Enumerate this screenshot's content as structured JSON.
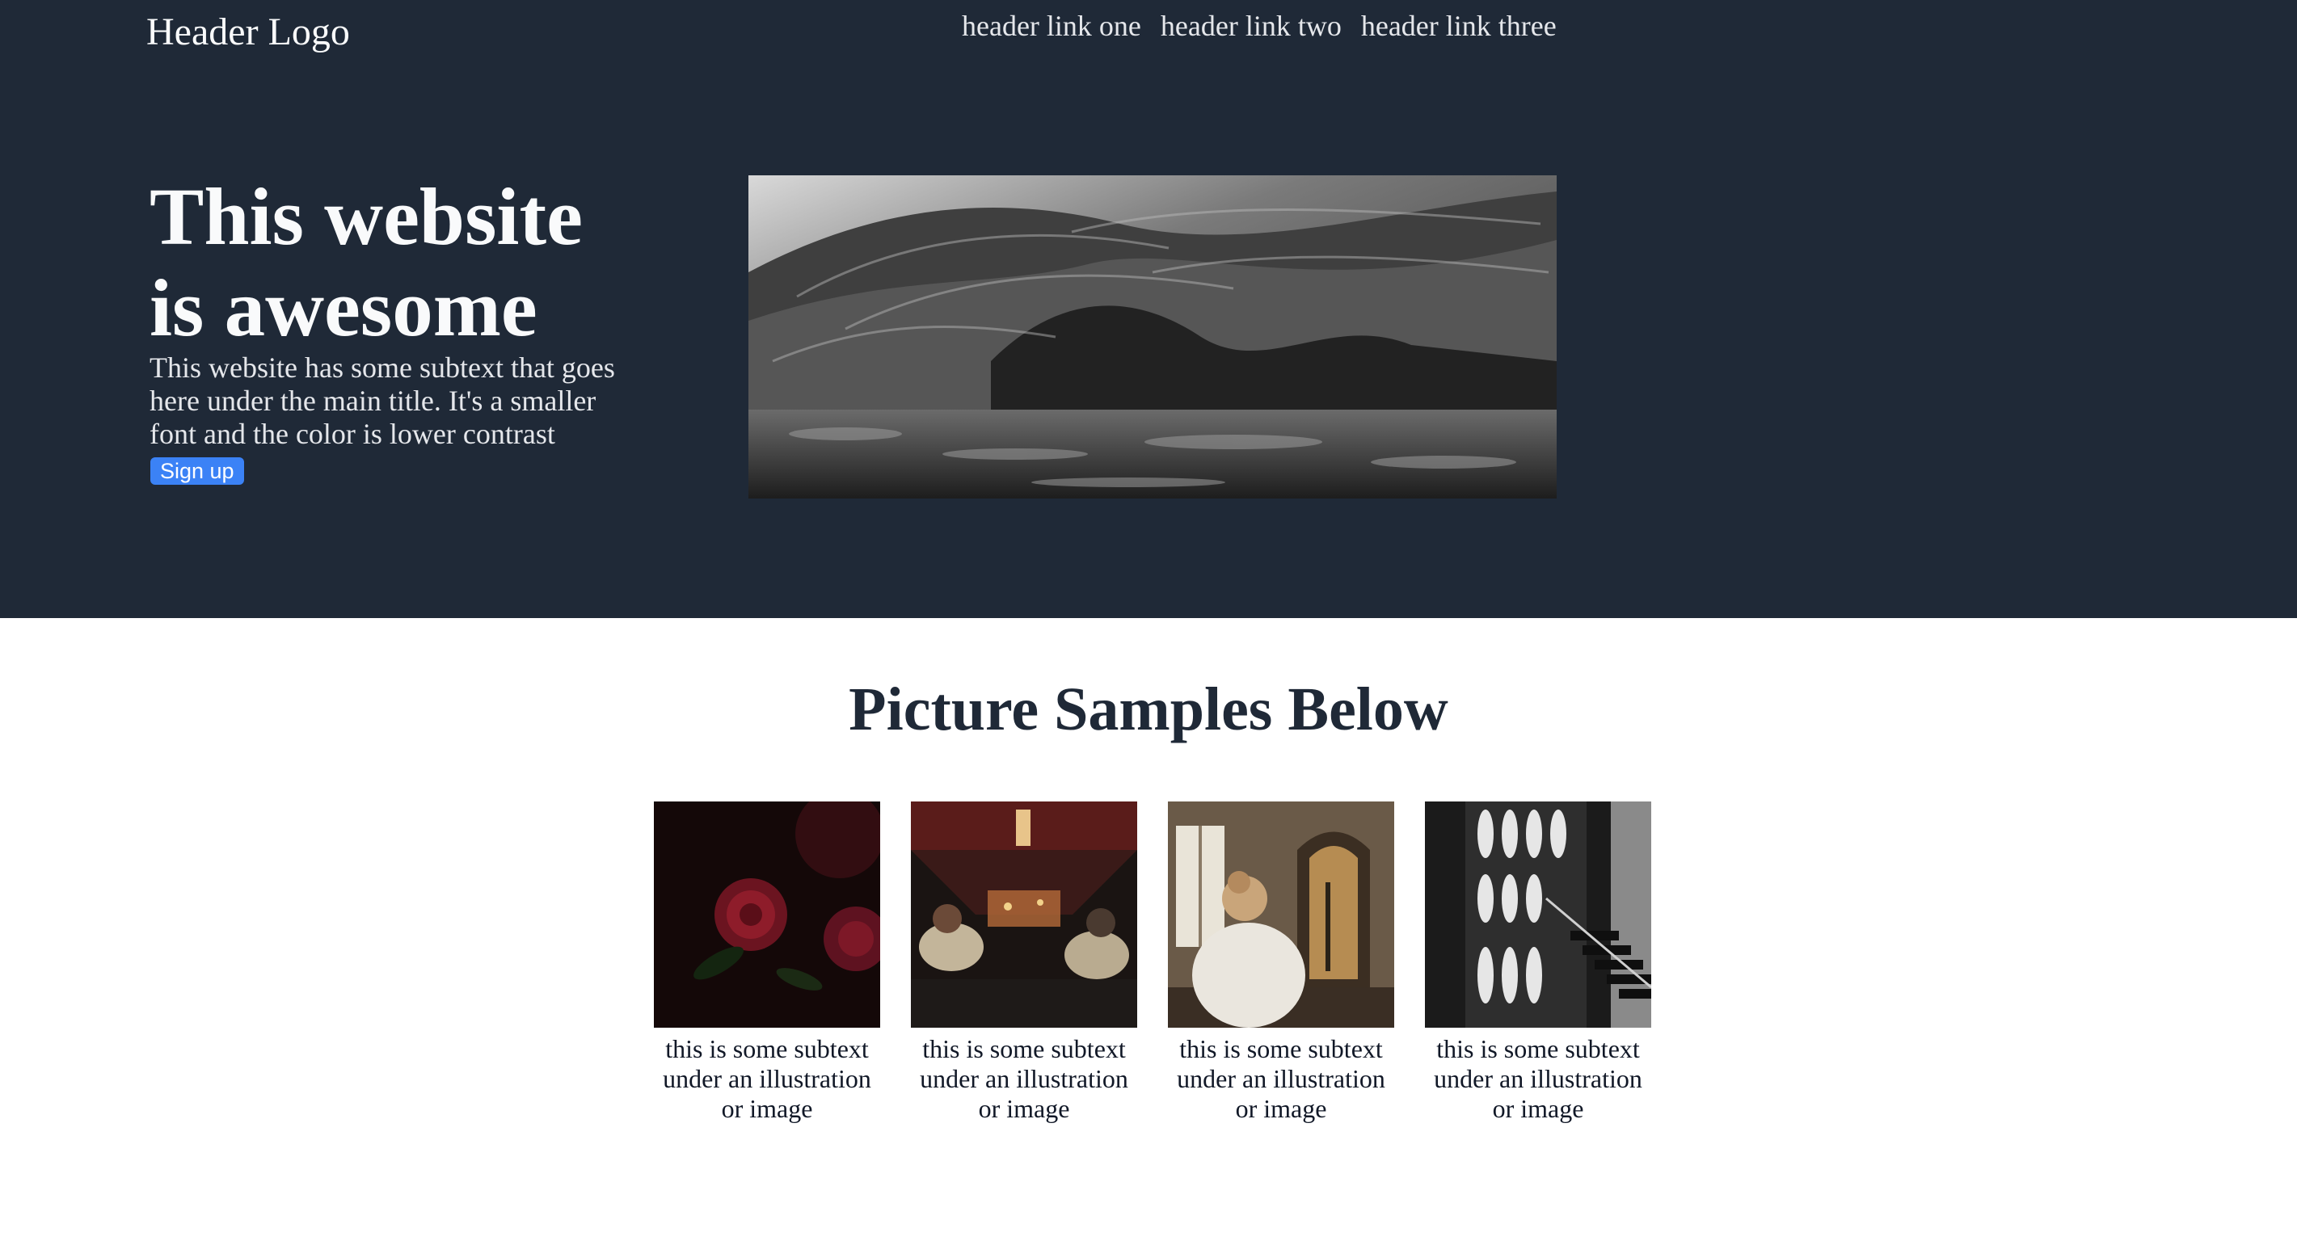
{
  "header": {
    "logo": "Header Logo",
    "links": [
      "header link one",
      "header link two",
      "header link three"
    ]
  },
  "hero": {
    "title": "This website is awesome",
    "subtext": "This website has some subtext that goes here under the main title. It's a smaller font and the color is lower contrast",
    "signup_label": "Sign up"
  },
  "samples": {
    "heading": "Picture Samples Below",
    "cards": [
      {
        "caption": "this is some subtext under an illustration or image"
      },
      {
        "caption": "this is some subtext under an illustration or image"
      },
      {
        "caption": "this is some subtext under an illustration or image"
      },
      {
        "caption": "this is some subtext under an illustration or image"
      }
    ]
  },
  "colors": {
    "hero_background": "#1f2937",
    "accent": "#3b82f6",
    "heading_text": "#1f2937"
  }
}
